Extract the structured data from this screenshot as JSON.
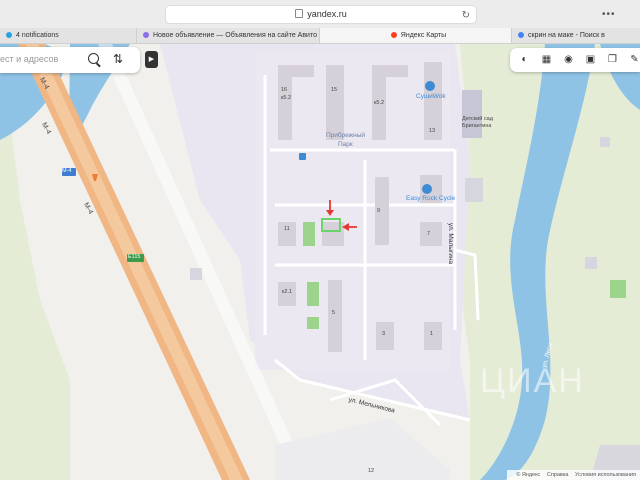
{
  "browser": {
    "url": "yandex.ru",
    "tabs": [
      {
        "label": "4 notifications",
        "color": "#2aa3e0"
      },
      {
        "label": "Новое объявление — Объявления на сайте Авито",
        "color": "#8a6de9"
      },
      {
        "label": "Яндекс Карты",
        "color": "#fc3f1d"
      },
      {
        "label": "скрин на маке - Поиск в",
        "color": "#4285f4"
      }
    ]
  },
  "search": {
    "placeholder": "ест и адресов"
  },
  "map": {
    "road_labels": [
      {
        "text": "М-4"
      },
      {
        "text": "М-4"
      },
      {
        "text": "М-4"
      },
      {
        "text": "М-4"
      },
      {
        "text": "E115"
      }
    ],
    "places": [
      {
        "text": "Прибрежный"
      },
      {
        "text": "Парк"
      },
      {
        "text": "СушиWok"
      },
      {
        "text": "Детский сад"
      },
      {
        "text": "Бригантина"
      },
      {
        "text": "Easy Rock Cycle"
      }
    ],
    "streets": [
      {
        "text": "ул. Малыгина"
      },
      {
        "text": "ул. Мельникова"
      },
      {
        "text": "ул. Лесн"
      }
    ],
    "building_numbers": [
      "16",
      "к5.2",
      "15",
      "к5.2",
      "13",
      "11",
      "9",
      "7",
      "к2.1",
      "5",
      "3",
      "1",
      "12"
    ],
    "watermark": "ЦИАН",
    "marker_color": "#e53935",
    "highlight_color": "#6ad36a"
  },
  "attribution": {
    "copyright": "© Яндекс",
    "help": "Справка",
    "terms": "Условия использования"
  }
}
